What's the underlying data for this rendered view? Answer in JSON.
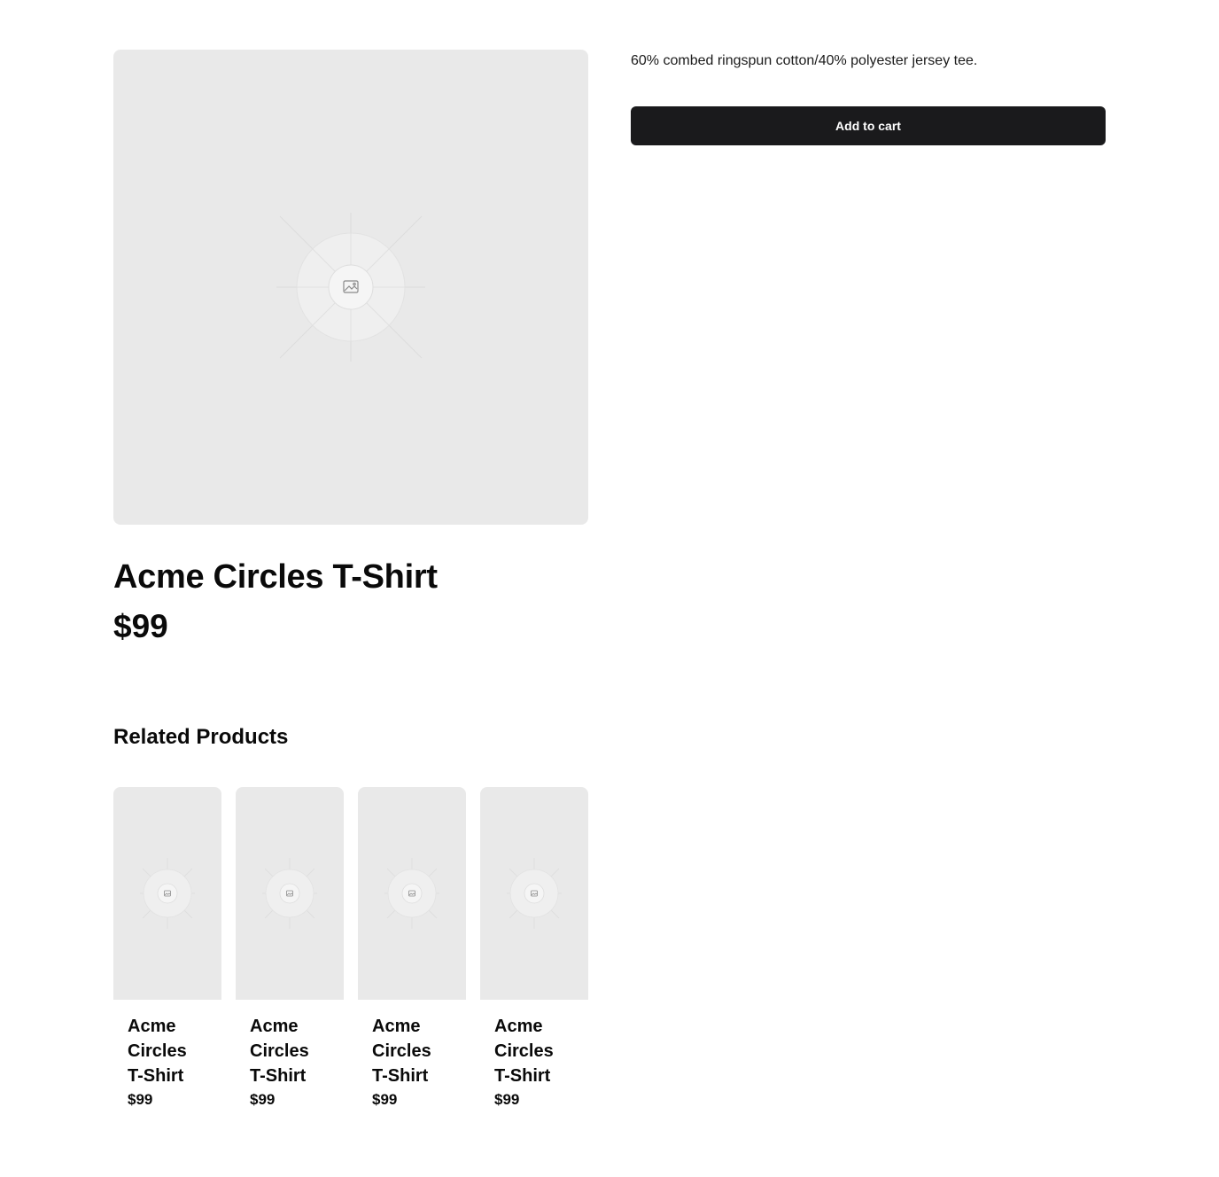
{
  "product": {
    "title": "Acme Circles T-Shirt",
    "price": "$99",
    "description": "60% combed ringspun cotton/40% polyester jersey tee.",
    "image_icon": "image-placeholder-icon"
  },
  "actions": {
    "add_to_cart_label": "Add to cart"
  },
  "related": {
    "heading": "Related Products",
    "items": [
      {
        "title": "Acme Circles T-Shirt",
        "price": "$99"
      },
      {
        "title": "Acme Circles T-Shirt",
        "price": "$99"
      },
      {
        "title": "Acme Circles T-Shirt",
        "price": "$99"
      },
      {
        "title": "Acme Circles T-Shirt",
        "price": "$99"
      }
    ]
  },
  "colors": {
    "button_bg": "#1a1a1c",
    "placeholder_bg": "#e9e9e9",
    "text": "#0a0a0a"
  }
}
